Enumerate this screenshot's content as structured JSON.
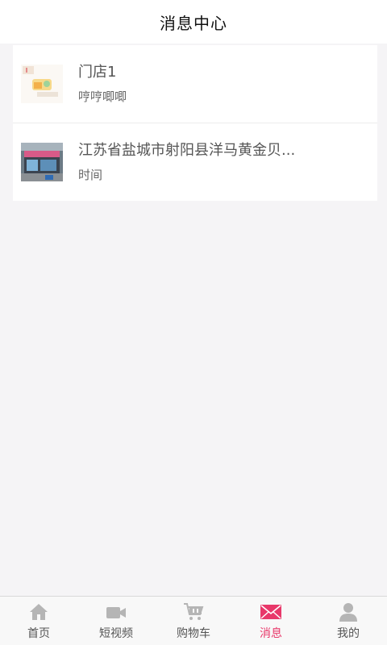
{
  "header": {
    "title": "消息中心"
  },
  "messages": [
    {
      "title": "门店1",
      "subtitle": "哼哼唧唧"
    },
    {
      "title": "江苏省盐城市射阳县洋马黄金贝...",
      "subtitle": "时间"
    }
  ],
  "tabbar": {
    "items": [
      {
        "label": "首页",
        "icon": "home-icon"
      },
      {
        "label": "短视频",
        "icon": "video-camera-icon"
      },
      {
        "label": "购物车",
        "icon": "shopping-cart-icon"
      },
      {
        "label": "消息",
        "icon": "envelope-icon",
        "active": true
      },
      {
        "label": "我的",
        "icon": "user-icon"
      }
    ],
    "active_color": "#e8386a",
    "inactive_color": "#b5b5b5"
  }
}
